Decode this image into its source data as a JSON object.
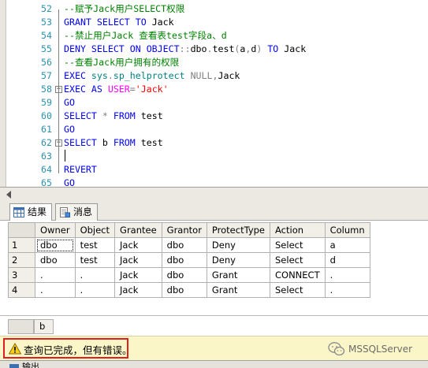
{
  "editor": {
    "lines": [
      {
        "num": "52",
        "fold": "",
        "tokens": [
          {
            "t": "--赋予Jack用户SELECT权限",
            "c": "cm"
          }
        ]
      },
      {
        "num": "53",
        "fold": "",
        "tokens": [
          {
            "t": "GRANT SELECT TO ",
            "c": "kw"
          },
          {
            "t": "Jack",
            "c": "txt"
          }
        ]
      },
      {
        "num": "54",
        "fold": "",
        "tokens": [
          {
            "t": "--禁止用户Jack 查看表test字段a、d",
            "c": "cm"
          }
        ]
      },
      {
        "num": "55",
        "fold": "",
        "tokens": [
          {
            "t": "DENY SELECT ON OBJECT",
            "c": "kw"
          },
          {
            "t": "::",
            "c": "gray"
          },
          {
            "t": "dbo",
            "c": "txt"
          },
          {
            "t": ".",
            "c": "gray"
          },
          {
            "t": "test",
            "c": "txt"
          },
          {
            "t": "(",
            "c": "gray"
          },
          {
            "t": "a",
            "c": "txt"
          },
          {
            "t": ",",
            "c": "gray"
          },
          {
            "t": "d",
            "c": "txt"
          },
          {
            "t": ") ",
            "c": "gray"
          },
          {
            "t": "TO ",
            "c": "kw"
          },
          {
            "t": "Jack",
            "c": "txt"
          }
        ]
      },
      {
        "num": "56",
        "fold": "",
        "tokens": [
          {
            "t": "--查看Jack用户拥有的权限",
            "c": "cm"
          }
        ]
      },
      {
        "num": "57",
        "fold": "",
        "tokens": [
          {
            "t": "EXEC ",
            "c": "kw"
          },
          {
            "t": "sys",
            "c": "sys"
          },
          {
            "t": ".",
            "c": "gray"
          },
          {
            "t": "sp_helprotect ",
            "c": "sys"
          },
          {
            "t": "NULL",
            "c": "gray"
          },
          {
            "t": ",",
            "c": "gray"
          },
          {
            "t": "Jack",
            "c": "txt"
          }
        ]
      },
      {
        "num": "58",
        "fold": "minus",
        "tokens": [
          {
            "t": "EXEC AS ",
            "c": "kw"
          },
          {
            "t": "USER",
            "c": "fn"
          },
          {
            "t": "=",
            "c": "gray"
          },
          {
            "t": "'Jack'",
            "c": "str"
          }
        ]
      },
      {
        "num": "59",
        "fold": "",
        "tokens": [
          {
            "t": "GO",
            "c": "kw"
          }
        ]
      },
      {
        "num": "60",
        "fold": "",
        "tokens": [
          {
            "t": "SELECT ",
            "c": "kw"
          },
          {
            "t": "* ",
            "c": "gray"
          },
          {
            "t": "FROM ",
            "c": "kw"
          },
          {
            "t": "test",
            "c": "txt"
          }
        ]
      },
      {
        "num": "61",
        "fold": "",
        "tokens": [
          {
            "t": "GO",
            "c": "kw"
          }
        ]
      },
      {
        "num": "62",
        "fold": "minus",
        "tokens": [
          {
            "t": "SELECT ",
            "c": "kw"
          },
          {
            "t": "b ",
            "c": "txt"
          },
          {
            "t": "FROM ",
            "c": "kw"
          },
          {
            "t": "test",
            "c": "txt"
          }
        ]
      },
      {
        "num": "63",
        "fold": "",
        "tokens": []
      },
      {
        "num": "64",
        "fold": "end",
        "tokens": [
          {
            "t": "REVERT",
            "c": "kw"
          }
        ]
      },
      {
        "num": "65",
        "fold": "",
        "tokens": [
          {
            "t": "GO",
            "c": "kw"
          }
        ]
      }
    ]
  },
  "tabs": [
    {
      "label": "结果",
      "active": true
    },
    {
      "label": "消息",
      "active": false
    }
  ],
  "grid": {
    "columns": [
      "Owner",
      "Object",
      "Grantee",
      "Grantor",
      "ProtectType",
      "Action",
      "Column"
    ],
    "rows": [
      {
        "num": "1",
        "cells": [
          "dbo",
          "test",
          "Jack",
          "dbo",
          "Deny",
          "Select",
          "a"
        ]
      },
      {
        "num": "2",
        "cells": [
          "dbo",
          "test",
          "Jack",
          "dbo",
          "Deny",
          "Select",
          "d"
        ]
      },
      {
        "num": "3",
        "cells": [
          ".",
          ".",
          "Jack",
          "dbo",
          "Grant",
          "CONNECT",
          "."
        ]
      },
      {
        "num": "4",
        "cells": [
          ".",
          ".",
          "Jack",
          "dbo",
          "Grant",
          "Select",
          "."
        ]
      }
    ]
  },
  "grid2": {
    "columns": [
      "b"
    ]
  },
  "status": {
    "message": "查询已完成，但有错误。"
  },
  "watermark": {
    "text": "MSSQLServer"
  },
  "bottom": {
    "output_label": "输出"
  },
  "colors": {
    "status_bg": "#fbf6c8",
    "error_border": "#e02020",
    "keyword": "#0000ff",
    "comment": "#008000"
  }
}
